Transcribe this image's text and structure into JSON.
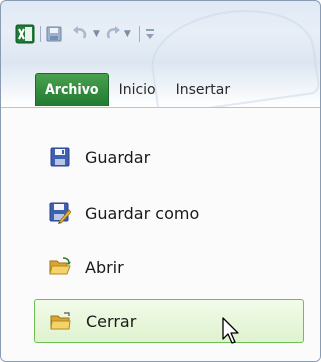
{
  "ribbon": {
    "tabs": [
      {
        "label": "Archivo",
        "active": true
      },
      {
        "label": "Inicio"
      },
      {
        "label": "Insertar"
      }
    ],
    "accent_color": "#1f7a31"
  },
  "quick_access": {
    "icons": [
      "excel-logo-icon",
      "save-icon",
      "undo-icon",
      "redo-icon",
      "customize-qat-icon"
    ]
  },
  "file_menu": {
    "items": [
      {
        "label": "Guardar",
        "icon": "save-icon"
      },
      {
        "label": "Guardar como",
        "icon": "save-as-icon"
      },
      {
        "label": "Abrir",
        "icon": "open-folder-icon"
      },
      {
        "label": "Cerrar",
        "icon": "close-folder-icon",
        "hovered": true
      }
    ]
  }
}
